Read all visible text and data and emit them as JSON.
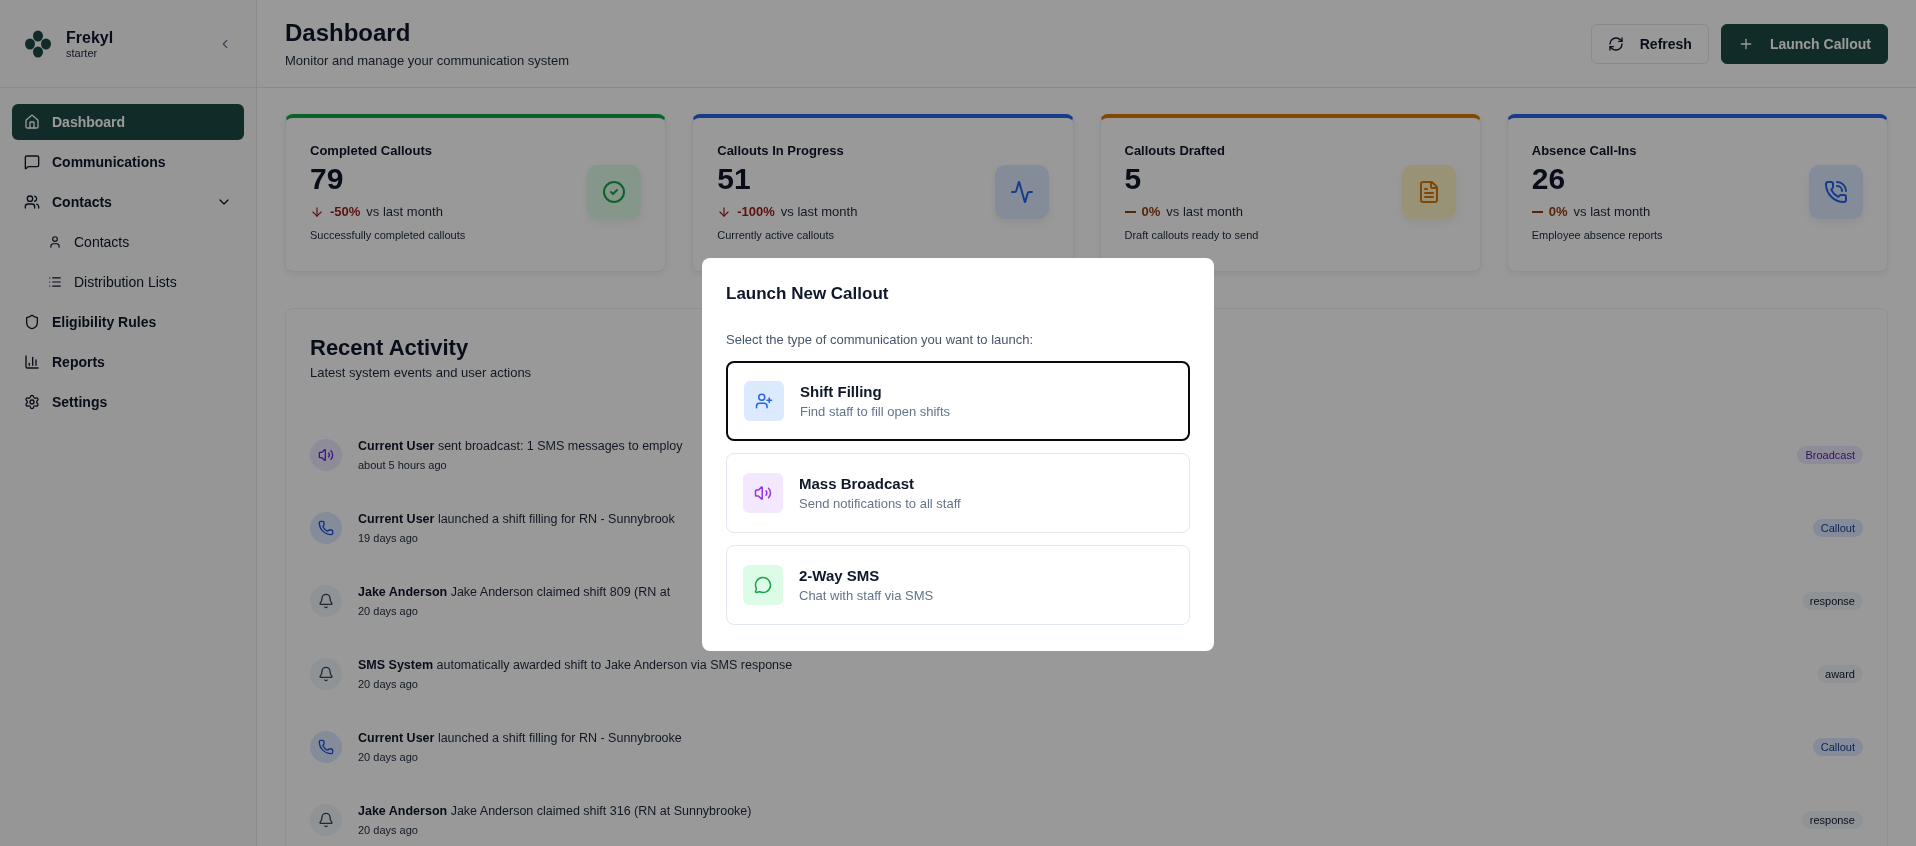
{
  "brand": {
    "name": "Frekyl",
    "plan": "starter"
  },
  "sidebar": {
    "items": [
      {
        "label": "Dashboard",
        "selected": true
      },
      {
        "label": "Communications",
        "selected": false
      },
      {
        "label": "Contacts",
        "selected": false,
        "expanded": true,
        "children": [
          {
            "label": "Contacts",
            "selected": false
          },
          {
            "label": "Distribution Lists",
            "selected": false
          }
        ]
      },
      {
        "label": "Eligibility Rules",
        "selected": false
      },
      {
        "label": "Reports",
        "selected": false
      },
      {
        "label": "Settings",
        "selected": false
      }
    ]
  },
  "header": {
    "title": "Dashboard",
    "subtitle": "Monitor and manage your communication system",
    "buttons": [
      {
        "label": "Refresh",
        "kind": "outline"
      },
      {
        "label": "Launch Callout",
        "kind": "primary"
      }
    ]
  },
  "stats": [
    {
      "kind": "completed",
      "title": "Completed Callouts",
      "value": "79",
      "falling": true,
      "change": "-50%",
      "compare": "vs last month",
      "note": "Successfully completed callouts"
    },
    {
      "kind": "progress",
      "title": "Callouts In Progress",
      "value": "51",
      "falling": true,
      "change": "-100%",
      "compare": "vs last month",
      "note": "Currently active callouts"
    },
    {
      "kind": "drafted",
      "title": "Callouts Drafted",
      "value": "5",
      "falling": false,
      "change": "0%",
      "compare": "vs last month",
      "note": "Draft callouts ready to send"
    },
    {
      "kind": "absence",
      "title": "Absence Call-Ins",
      "value": "26",
      "falling": false,
      "change": "0%",
      "compare": "vs last month",
      "note": "Employee absence reports"
    }
  ],
  "activity": {
    "title": "Recent Activity",
    "subtitle": "Latest system events and user actions",
    "items": [
      {
        "kind": "broadcast",
        "text": "**Current User** sent broadcast: 1 SMS messages to employ",
        "time": "about 5 hours ago",
        "tag": "Broadcast"
      },
      {
        "kind": "callout",
        "text": "**Current User** launched a shift filling for RN - Sunnybrook",
        "time": "19 days ago",
        "tag": "Callout"
      },
      {
        "kind": "notice",
        "text": "**Jake Anderson** Jake Anderson claimed shift 809 (RN at",
        "time": "20 days ago",
        "tag": "response"
      },
      {
        "kind": "notice",
        "text": "**SMS System** automatically awarded shift to Jake Anderson via SMS response",
        "time": "20 days ago",
        "tag": "award"
      },
      {
        "kind": "callout",
        "text": "**Current User** launched a shift filling for RN - Sunnybrooke",
        "time": "20 days ago",
        "tag": "Callout"
      },
      {
        "kind": "notice",
        "text": "**Jake Anderson** Jake Anderson claimed shift 316 (RN at Sunnybrooke)",
        "time": "20 days ago",
        "tag": "response"
      }
    ]
  },
  "modal": {
    "title": "Launch New Callout",
    "description": "Select the type of communication you want to launch:",
    "options": [
      {
        "kind": "shift",
        "title": "Shift Filling",
        "subtitle": "Find staff to fill open shifts",
        "selected": true
      },
      {
        "kind": "broadcast",
        "title": "Mass Broadcast",
        "subtitle": "Send notifications to all staff",
        "selected": false
      },
      {
        "kind": "sms",
        "title": "2-Way SMS",
        "subtitle": "Chat with staff via SMS",
        "selected": false
      }
    ]
  }
}
